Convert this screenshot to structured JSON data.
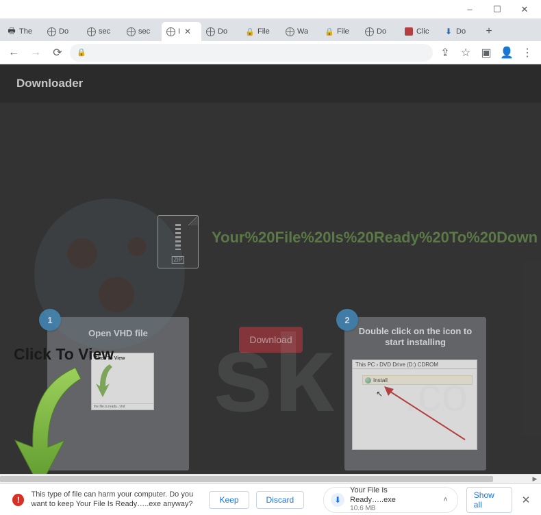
{
  "window": {
    "minimize": "–",
    "maximize": "☐",
    "close": "✕"
  },
  "tabs": [
    {
      "title": "The",
      "icon": "print"
    },
    {
      "title": "Do",
      "icon": "globe"
    },
    {
      "title": "sec",
      "icon": "globe"
    },
    {
      "title": "sec",
      "icon": "globe"
    },
    {
      "title": "I",
      "icon": "globe",
      "active": true
    },
    {
      "title": "Do",
      "icon": "globe"
    },
    {
      "title": "File",
      "icon": "lock"
    },
    {
      "title": "Wa",
      "icon": "globe"
    },
    {
      "title": "File",
      "icon": "lock"
    },
    {
      "title": "Do",
      "icon": "globe"
    },
    {
      "title": "Clic",
      "icon": "red"
    },
    {
      "title": "Do",
      "icon": "blue"
    }
  ],
  "nav": {
    "back": "←",
    "forward": "→",
    "reload": "⟳",
    "lock": "🔒"
  },
  "toolbar": {
    "share": "⇪",
    "star": "☆",
    "panel": "▣",
    "profile": "👤",
    "menu": "⋮"
  },
  "site": {
    "header": "Downloader"
  },
  "page": {
    "title": "Your%20File%20Is%20Ready%20To%20Down",
    "zip_label": "ZIP",
    "download_btn": "Download",
    "step1": {
      "num": "1",
      "title": "Open VHD file",
      "thumb_label": "Click To View",
      "thumb_footer": "the.file.is.ready...vhd"
    },
    "step2": {
      "num": "2",
      "title": "Double click on the icon to start installing",
      "crumb_a": "This PC",
      "crumb_sep": "›",
      "crumb_b": "DVD Drive (D:) CDROM",
      "row_label": "Install"
    },
    "overlay_text": "Click To View"
  },
  "shelf": {
    "warning": "This type of file can harm your computer. Do you want to keep Your File Is Ready…..exe anyway?",
    "keep": "Keep",
    "discard": "Discard",
    "file_name": "Your File Is Ready…..exe",
    "file_size": "10.6 MB",
    "show_all": "Show all",
    "close": "✕"
  }
}
